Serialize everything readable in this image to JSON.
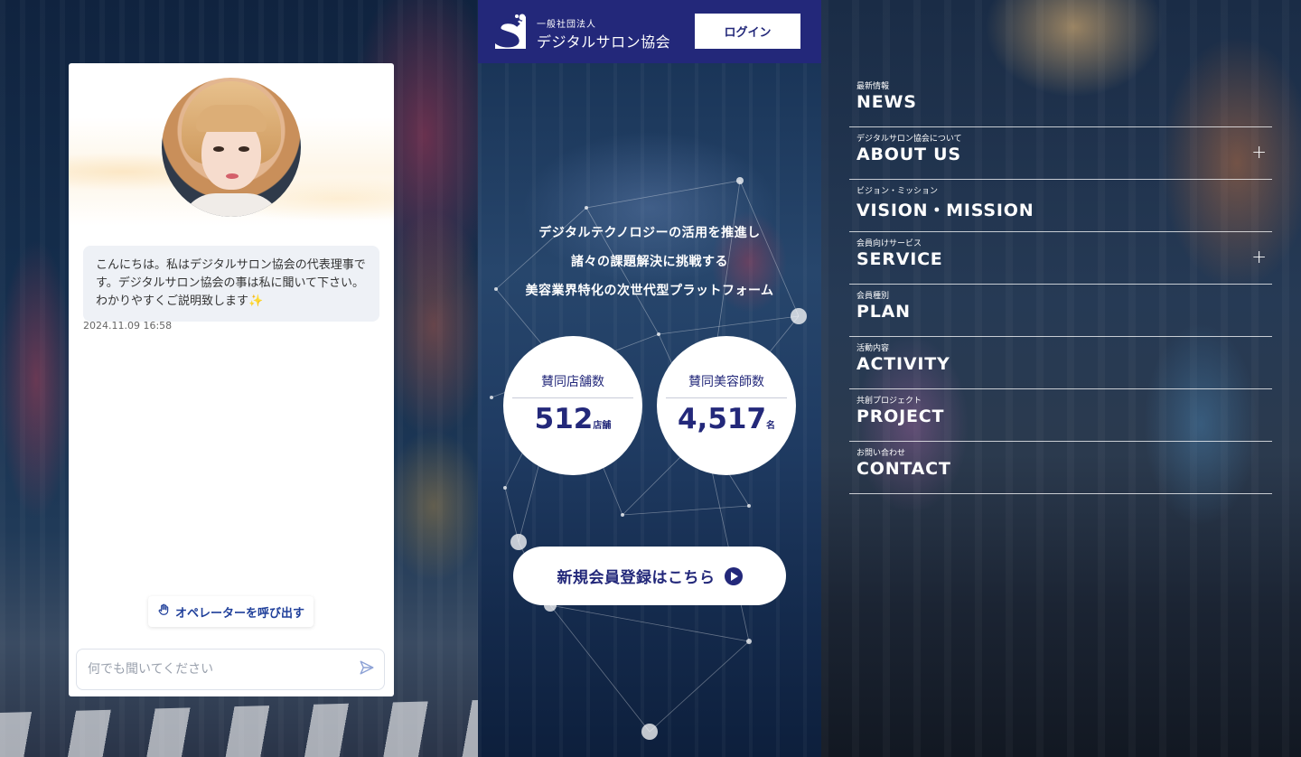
{
  "chat": {
    "message": "こんにちは。私はデジタルサロン協会の代表理事です。デジタルサロン協会の事は私に聞いて下さい。わかりやすくご説明致します✨",
    "timestamp": "2024.11.09 16:58",
    "operator_label": "オペレーターを呼び出す",
    "input_placeholder": "何でも聞いてください"
  },
  "header": {
    "org_small": "一般社団法人",
    "org_name": "デジタルサロン協会",
    "login_label": "ログイン"
  },
  "hero": {
    "taglines": [
      "デジタルテクノロジーの活用を推進し",
      "諸々の課題解決に挑戦する",
      "美容業界特化の次世代型プラットフォーム"
    ],
    "stats": [
      {
        "label": "賛同店舗数",
        "value": "512",
        "unit": "店舗"
      },
      {
        "label": "賛同美容師数",
        "value": "4,517",
        "unit": "名"
      }
    ],
    "register_label": "新規会員登録はこちら"
  },
  "nav": {
    "items": [
      {
        "sub": "最新情報",
        "main": "NEWS",
        "plus": ""
      },
      {
        "sub": "デジタルサロン協会について",
        "main": "ABOUT US",
        "plus": "+"
      },
      {
        "sub": "ビジョン・ミッション",
        "main": "VISION・MISSION",
        "plus": ""
      },
      {
        "sub": "会員向けサービス",
        "main": "SERVICE",
        "plus": "+"
      },
      {
        "sub": "会員種別",
        "main": "PLAN",
        "plus": ""
      },
      {
        "sub": "活動内容",
        "main": "ACTIVITY",
        "plus": ""
      },
      {
        "sub": "共創プロジェクト",
        "main": "PROJECT",
        "plus": ""
      },
      {
        "sub": "お問い合わせ",
        "main": "CONTACT",
        "plus": ""
      }
    ]
  },
  "colors": {
    "brand_navy": "#23287a",
    "chat_bubble": "#eef1f6",
    "operator_text": "#1f3f9a"
  },
  "icons": {
    "operator": "hand-icon",
    "send": "send-icon",
    "register": "play-circle-icon",
    "logo": "logo-s-icon"
  }
}
